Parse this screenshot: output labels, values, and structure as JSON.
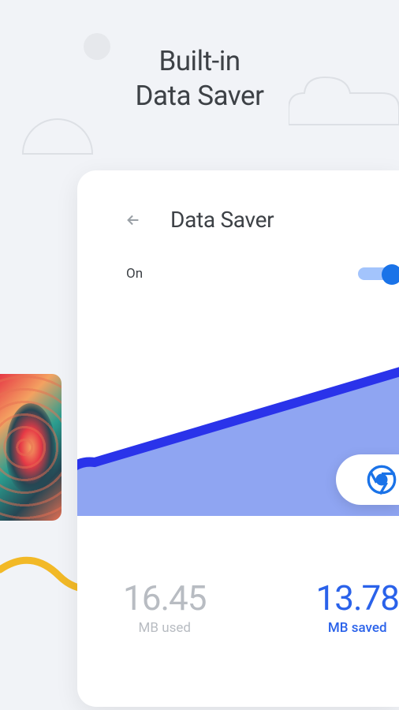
{
  "hero": {
    "line1": "Built-in",
    "line2": "Data Saver"
  },
  "card": {
    "title": "Data Saver",
    "toggle": {
      "label": "On",
      "state": true
    }
  },
  "stats": {
    "used": {
      "value": "16.45",
      "label": "MB used"
    },
    "saved": {
      "value": "13.78",
      "label": "MB saved"
    }
  },
  "icons": {
    "back": "back-arrow-icon",
    "chrome": "chrome-icon"
  },
  "chart_data": {
    "type": "area",
    "note": "Stylized savings area chart; no axes or labels shown",
    "series": [
      {
        "name": "saved",
        "color": "#8fa5f2",
        "stroke": "#2a33ea"
      }
    ]
  }
}
